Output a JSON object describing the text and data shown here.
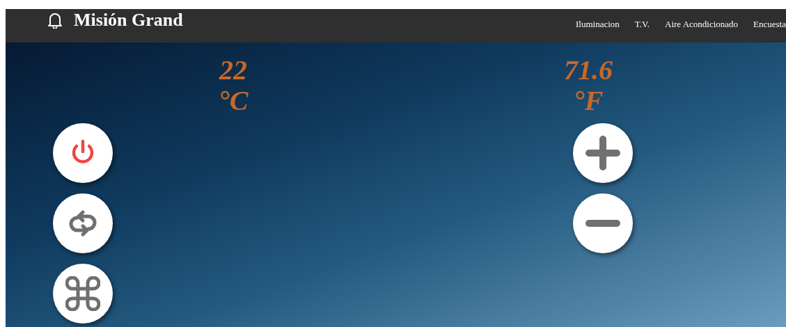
{
  "header": {
    "title": "Misión Grand",
    "nav": [
      {
        "label": "Iluminacion"
      },
      {
        "label": "T.V."
      },
      {
        "label": "Aire Acondicionado"
      },
      {
        "label": "Encuesta"
      }
    ]
  },
  "temperatures": [
    {
      "value": "22",
      "unit": "°C"
    },
    {
      "value": "71.6",
      "unit": "°F"
    }
  ],
  "controls": {
    "left": [
      {
        "kind": "power"
      },
      {
        "kind": "swap"
      },
      {
        "kind": "mode"
      }
    ],
    "right": [
      {
        "kind": "increase"
      },
      {
        "kind": "decrease"
      }
    ]
  }
}
